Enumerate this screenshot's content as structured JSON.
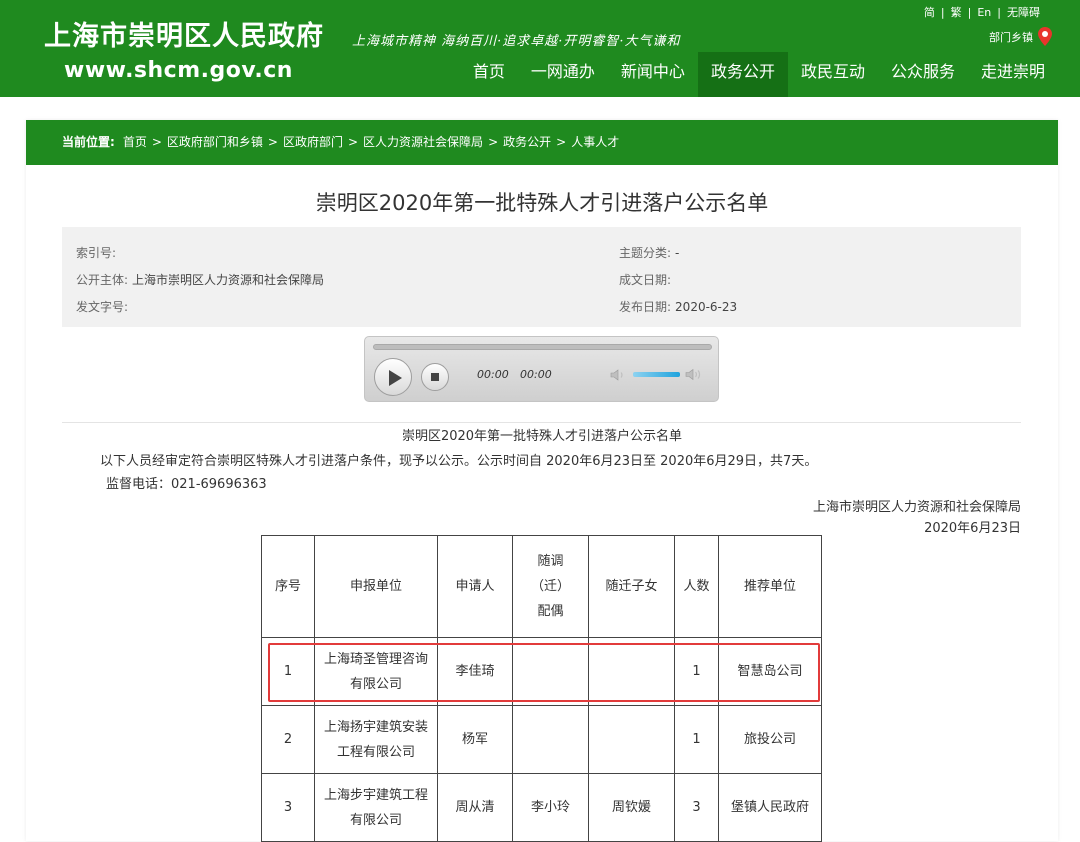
{
  "header": {
    "site_title": "上海市崇明区人民政府",
    "site_url": "www.shcm.gov.cn",
    "slogan": "上海城市精神  海纳百川·追求卓越·开明睿智·大气谦和",
    "top_links": [
      "简",
      "繁",
      "En",
      "无障碍"
    ],
    "dept_link": "部门乡镇",
    "nav": [
      "首页",
      "一网通办",
      "新闻中心",
      "政务公开",
      "政民互动",
      "公众服务",
      "走进崇明"
    ],
    "active_nav": "政务公开"
  },
  "breadcrumb": {
    "label": "当前位置:",
    "items": [
      "首页",
      "区政府部门和乡镇",
      "区政府部门",
      "区人力资源社会保障局",
      "政务公开",
      "人事人才"
    ]
  },
  "document": {
    "title": "崇明区2020年第一批特殊人才引进落户公示名单",
    "meta": {
      "index_label": "索引号:",
      "index_value": "",
      "publisher_label": "公开主体:",
      "publisher_value": "上海市崇明区人力资源和社会保障局",
      "doc_no_label": "发文字号:",
      "doc_no_value": "",
      "topic_label": "主题分类:",
      "topic_value": "-",
      "created_label": "成文日期:",
      "created_value": "",
      "published_label": "发布日期:",
      "published_value": "2020-6-23"
    }
  },
  "player": {
    "current_time": "00:00",
    "duration": "00:00",
    "volume": 0.75
  },
  "body": {
    "heading": "崇明区2020年第一批特殊人才引进落户公示名单",
    "intro": "以下人员经审定符合崇明区特殊人才引进落户条件，现予以公示。公示时间自 2020年6月23日至 2020年6月29日，共7天。",
    "phone": "监督电话：021-69696363",
    "signature_org": "上海市崇明区人力资源和社会保障局",
    "signature_date": "2020年6月23日"
  },
  "table": {
    "headers": [
      "序号",
      "申报单位",
      "申请人",
      "随调（迁）配偶",
      "随迁子女",
      "人数",
      "推荐单位"
    ],
    "rows": [
      [
        "1",
        "上海琦圣管理咨询有限公司",
        "李佳琦",
        "",
        "",
        "1",
        "智慧岛公司"
      ],
      [
        "2",
        "上海扬宇建筑安装工程有限公司",
        "杨军",
        "",
        "",
        "1",
        "旅投公司"
      ],
      [
        "3",
        "上海步宇建筑工程有限公司",
        "周从清",
        "李小玲",
        "周钦媛",
        "3",
        "堡镇人民政府"
      ]
    ]
  },
  "colors": {
    "brand_green": "#1f8a1f",
    "nav_active": "#157015",
    "highlight_red": "#e23b3b"
  },
  "icons": [
    "location-pin-icon",
    "play-icon",
    "stop-icon",
    "volume-low-icon",
    "volume-high-icon"
  ]
}
